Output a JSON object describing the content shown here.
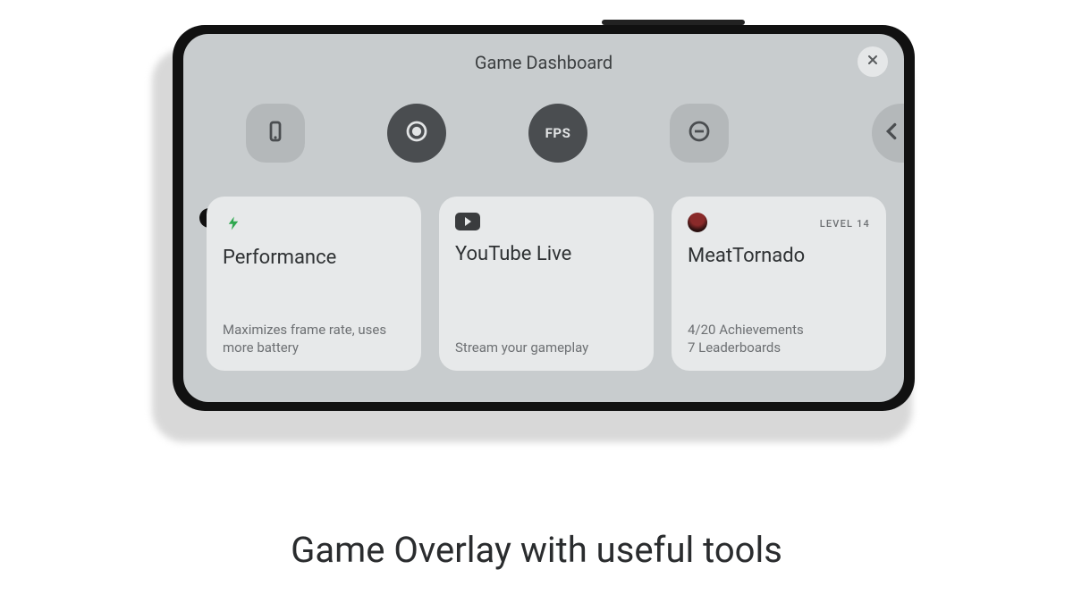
{
  "screen": {
    "title": "Game Dashboard",
    "close_label": "X"
  },
  "quick_icons": {
    "screenshot": "screenshot-icon",
    "record": "record-icon",
    "fps": "FPS",
    "dnd": "do-not-disturb-icon",
    "more": "more-icon"
  },
  "cards": {
    "performance": {
      "title": "Performance",
      "desc": "Maximizes frame rate, uses more battery"
    },
    "youtube": {
      "title": "YouTube Live",
      "desc": "Stream your gameplay"
    },
    "profile": {
      "name": "MeatTornado",
      "level": "LEVEL 14",
      "achievements": "4/20 Achievements",
      "leaderboards": "7 Leaderboards"
    }
  },
  "caption": "Game Overlay with useful tools"
}
